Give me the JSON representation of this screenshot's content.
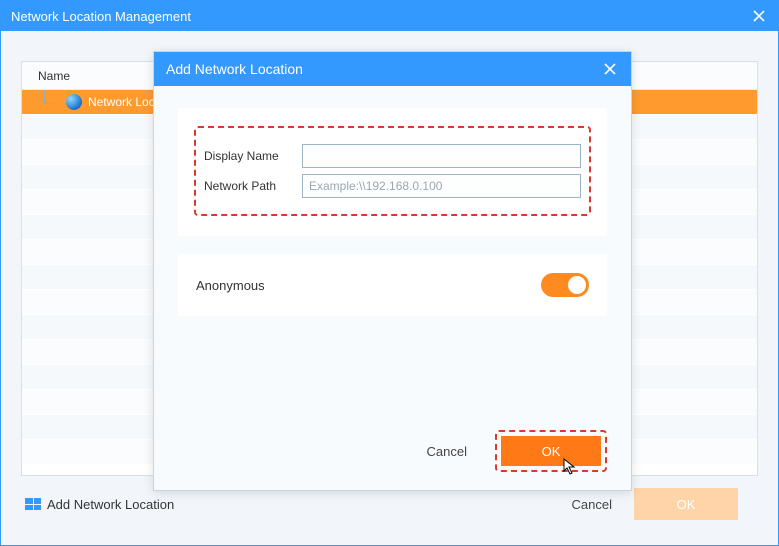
{
  "main": {
    "title": "Network Location Management",
    "table": {
      "header_name": "Name",
      "row_label": "Network Loc"
    },
    "footer": {
      "add_label": "Add Network Location",
      "cancel_label": "Cancel",
      "ok_label": "OK"
    }
  },
  "modal": {
    "title": "Add Network Location",
    "fields": {
      "display_name_label": "Display Name",
      "display_name_value": "",
      "network_path_label": "Network Path",
      "network_path_placeholder": "Example:\\\\192.168.0.100",
      "network_path_value": ""
    },
    "anonymous": {
      "label": "Anonymous",
      "on": true
    },
    "actions": {
      "cancel_label": "Cancel",
      "ok_label": "OK"
    }
  }
}
